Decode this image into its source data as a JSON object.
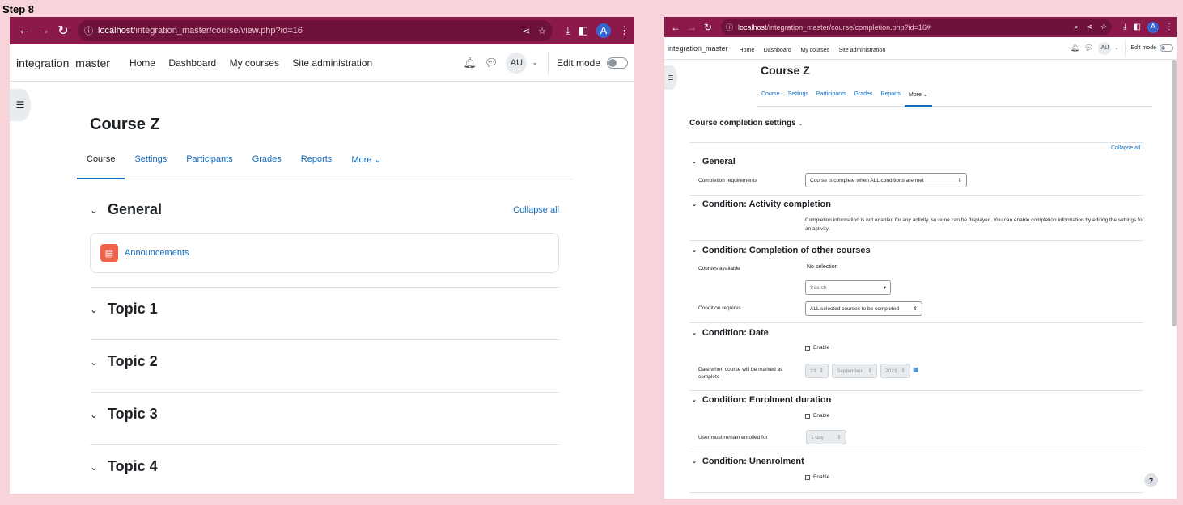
{
  "step_label": "Step 8",
  "left": {
    "url_host": "localhost",
    "url_path": "/integration_master/course/view.php?id=16",
    "profile_initial": "A",
    "brand": "integration_master",
    "menu": [
      "Home",
      "Dashboard",
      "My courses",
      "Site administration"
    ],
    "user_initials": "AU",
    "edit_mode": "Edit mode",
    "course_title": "Course Z",
    "tabs": [
      "Course",
      "Settings",
      "Participants",
      "Grades",
      "Reports",
      "More"
    ],
    "sections": {
      "general": "General",
      "collapse_all": "Collapse all",
      "activity": "Announcements",
      "topics": [
        "Topic 1",
        "Topic 2",
        "Topic 3",
        "Topic 4"
      ]
    }
  },
  "right": {
    "url_host": "localhost",
    "url_path": "/integration_master/course/completion.php?id=16#",
    "profile_initial": "A",
    "brand": "integration_master",
    "menu": [
      "Home",
      "Dashboard",
      "My courses",
      "Site administration"
    ],
    "user_initials": "AU",
    "edit_mode": "Edit mode",
    "course_title": "Course Z",
    "tabs": [
      "Course",
      "Settings",
      "Participants",
      "Grades",
      "Reports",
      "More"
    ],
    "page_heading": "Course completion settings",
    "collapse_all": "Collapse all",
    "general": {
      "title": "General",
      "completion_label": "Completion requirements",
      "completion_value": "Course is complete when ALL conditions are met"
    },
    "activity_completion": {
      "title": "Condition: Activity completion",
      "description": "Completion information is not enabled for any activity, so none can be displayed. You can enable completion information by editing the settings for an activity."
    },
    "other_courses": {
      "title": "Condition: Completion of other courses",
      "courses_label": "Courses available",
      "no_selection": "No selection",
      "search_placeholder": "Search",
      "requires_label": "Condition requires",
      "requires_value": "ALL selected courses to be completed"
    },
    "date": {
      "title": "Condition: Date",
      "enable": "Enable",
      "label": "Date when course will be marked as complete",
      "day": "23",
      "month": "September",
      "year": "2023"
    },
    "enrolment_duration": {
      "title": "Condition: Enrolment duration",
      "enable": "Enable",
      "label": "User must remain enrolled for",
      "value": "1 day"
    },
    "unenrolment": {
      "title": "Condition: Unenrolment",
      "enable": "Enable"
    },
    "help": "?"
  }
}
